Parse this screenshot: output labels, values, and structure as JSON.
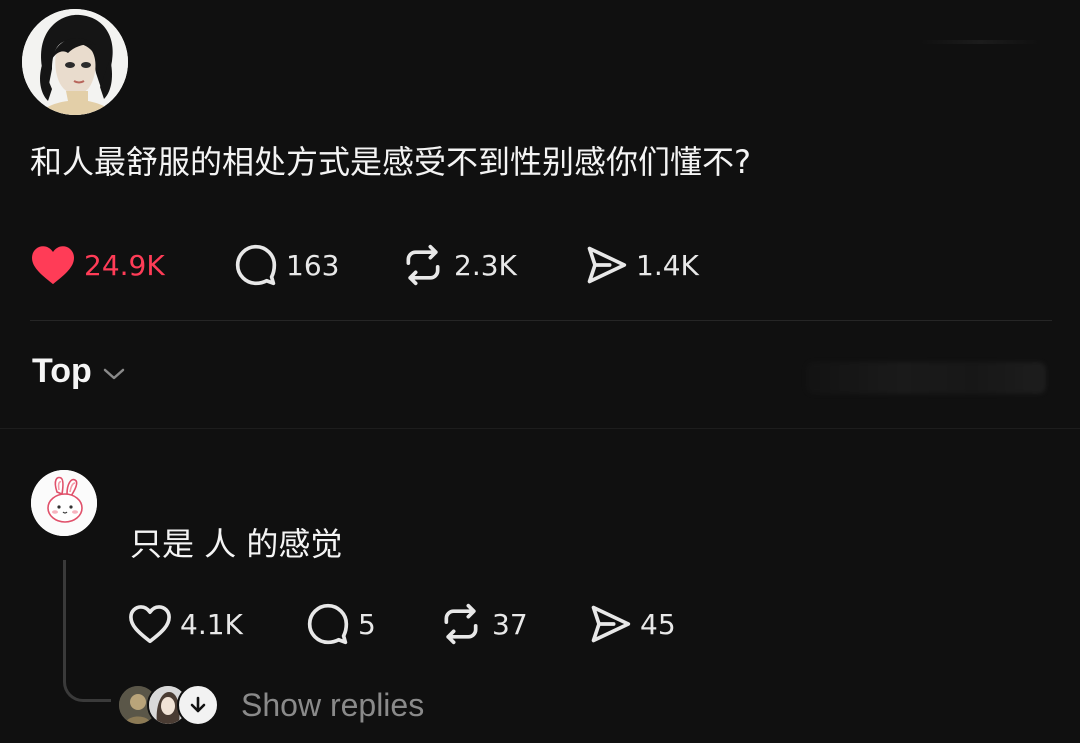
{
  "post": {
    "avatar_icon": "user-avatar-illustration",
    "text": "和人最舒服的相处方式是感受不到性别感你们懂不?",
    "likes": "24.9K",
    "replies": "163",
    "reposts": "2.3K",
    "shares": "1.4K",
    "like_color": "#ff3c57"
  },
  "sort": {
    "label": "Top"
  },
  "comment": {
    "avatar_icon": "bunny-avatar",
    "text": "只是 人 的感觉",
    "likes": "4.1K",
    "replies": "5",
    "reposts": "37",
    "shares": "45"
  },
  "show_replies": {
    "label": "Show replies"
  },
  "icons": {
    "like": "heart-icon",
    "reply": "comment-bubble-icon",
    "repost": "repost-arrows-icon",
    "share": "send-icon",
    "sort": "chevron-down-icon",
    "expand": "arrow-down-icon"
  }
}
